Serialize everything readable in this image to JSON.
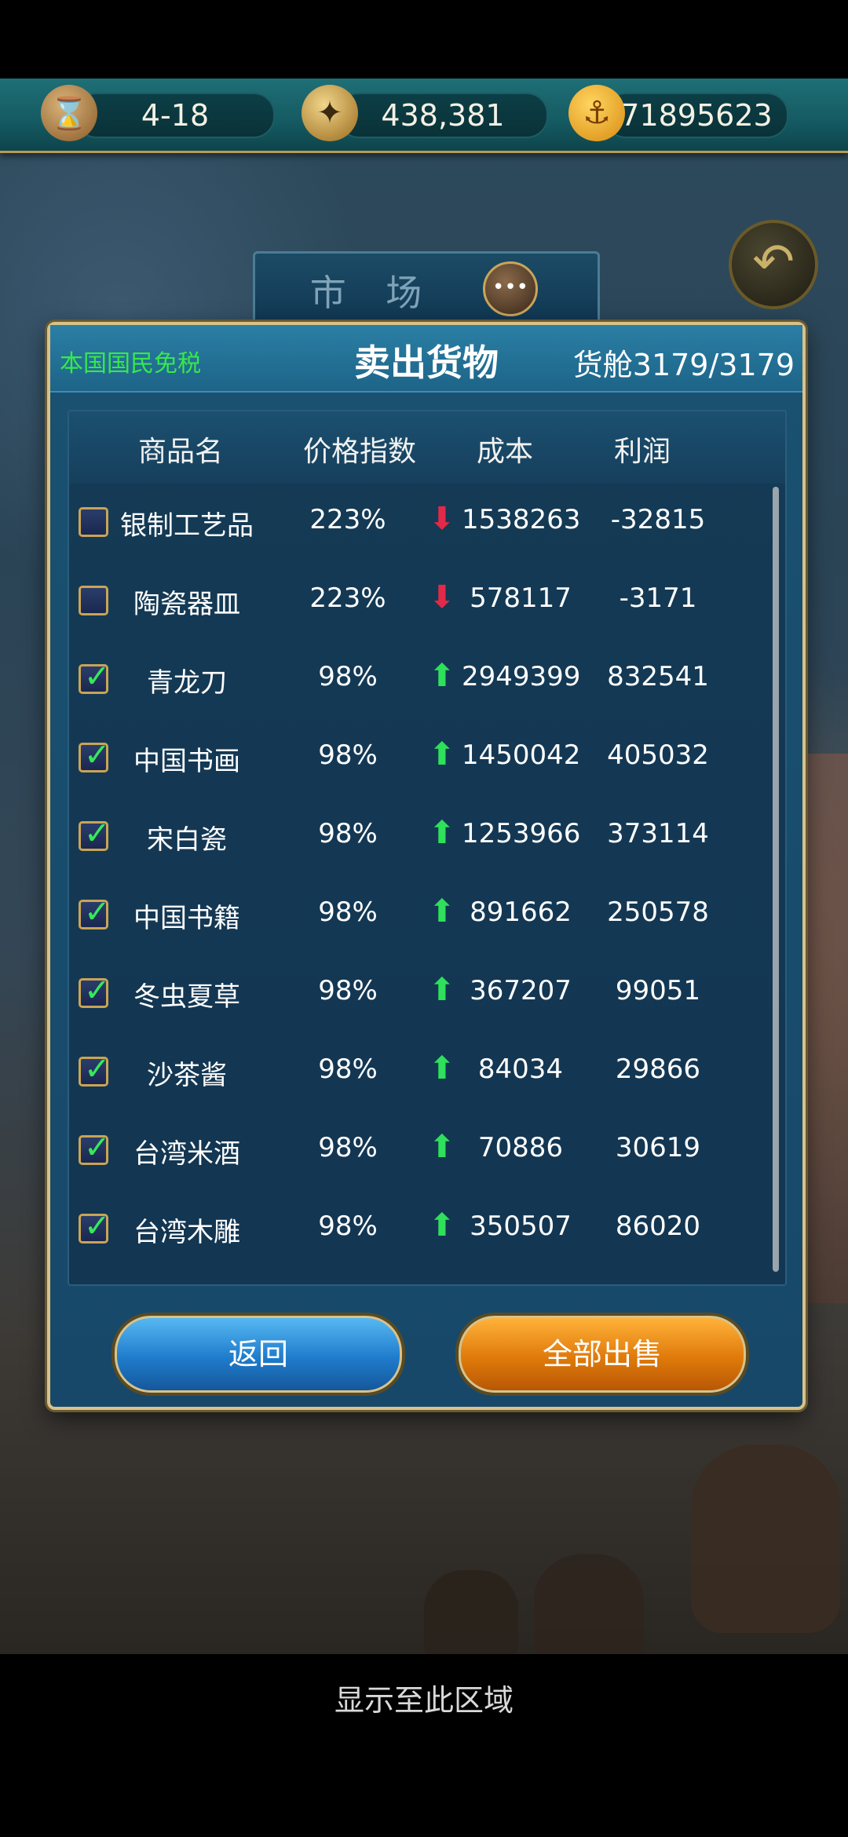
{
  "status_bar": {
    "date": "4-18",
    "compass_value": "438,381",
    "gold_value": "71895623"
  },
  "market": {
    "title": "市 场"
  },
  "dialog": {
    "tax_note": "本国国民免税",
    "title": "卖出货物",
    "hold": "货舱3179/3179"
  },
  "table": {
    "headers": {
      "name": "商品名",
      "price": "价格指数",
      "cost": "成本",
      "profit": "利润"
    },
    "rows": [
      {
        "name": "银制工艺品",
        "price": "223%",
        "trend": "down",
        "cost": "1538263",
        "profit": "-32815",
        "checked": false
      },
      {
        "name": "陶瓷器皿",
        "price": "223%",
        "trend": "down",
        "cost": "578117",
        "profit": "-3171",
        "checked": false
      },
      {
        "name": "青龙刀",
        "price": "98%",
        "trend": "up",
        "cost": "2949399",
        "profit": "832541",
        "checked": true
      },
      {
        "name": "中国书画",
        "price": "98%",
        "trend": "up",
        "cost": "1450042",
        "profit": "405032",
        "checked": true
      },
      {
        "name": "宋白瓷",
        "price": "98%",
        "trend": "up",
        "cost": "1253966",
        "profit": "373114",
        "checked": true
      },
      {
        "name": "中国书籍",
        "price": "98%",
        "trend": "up",
        "cost": "891662",
        "profit": "250578",
        "checked": true
      },
      {
        "name": "冬虫夏草",
        "price": "98%",
        "trend": "up",
        "cost": "367207",
        "profit": "99051",
        "checked": true
      },
      {
        "name": "沙茶酱",
        "price": "98%",
        "trend": "up",
        "cost": "84034",
        "profit": "29866",
        "checked": true
      },
      {
        "name": "台湾米酒",
        "price": "98%",
        "trend": "up",
        "cost": "70886",
        "profit": "30619",
        "checked": true
      },
      {
        "name": "台湾木雕",
        "price": "98%",
        "trend": "up",
        "cost": "350507",
        "profit": "86020",
        "checked": true
      }
    ]
  },
  "buttons": {
    "back": "返回",
    "sell_all": "全部出售"
  },
  "bottom_hint": "显示至此区域",
  "colors": {
    "accent_gold": "#d8c28a",
    "tax_note": "#37e84a",
    "trend_up": "#2ee05a",
    "trend_down": "#e22a48",
    "back_button": "#1f7ccc",
    "sell_button": "#e07a0a"
  },
  "icons": {
    "date": "hourglass-icon",
    "compass": "compass-icon",
    "gold": "anchor-coin-icon",
    "return": "return-arrow-icon",
    "chat": "chat-bubble-icon",
    "checked": "check-icon",
    "up": "arrow-up-icon",
    "down": "arrow-down-icon"
  }
}
